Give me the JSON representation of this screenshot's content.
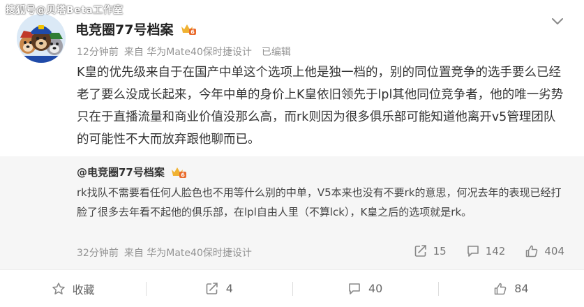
{
  "watermark": "搜狐号@贝塔Beta工作室",
  "post": {
    "author_name": "电竞圈77号档案",
    "badge_text": "6",
    "meta": {
      "time": "12分钟前",
      "source": "来自 华为Mate40保时捷设计",
      "edited": "已编辑"
    },
    "text": "K皇的优先级来自于在国产中单这个选项上他是独一档的，别的同位置竞争的选手要么已经老了要么没成长起来，今年中单的身价上K皇依旧领先于lpl其他同位竞争者，他的唯一劣势只在于直播流量和商业价值没那么高，而rk则因为很多俱乐部可能知道他离开v5管理团队的可能性不大而放弃跟他聊而已。"
  },
  "quote": {
    "author": "@电竞圈77号档案",
    "badge_text": "6",
    "text": "rk找队不需要看任何人脸色也不用等什么别的中单，V5本来也没有不要rk的意思，何况去年的表现已经打脸了很多去年看不起他的俱乐部，在lpl自由人里（不算lck），K皇之后的选项就是rk。",
    "meta": {
      "time": "32分钟前",
      "source": "来自 华为Mate40保时捷设计"
    },
    "stats": {
      "repost": "15",
      "comment": "142",
      "like": "404"
    }
  },
  "actions": {
    "favorite": "收藏",
    "repost": "4",
    "comment": "40",
    "like": "84"
  },
  "colors": {
    "badge": "#f0b232",
    "meta_text": "#939393",
    "quote_bg": "#f6f6f6"
  }
}
